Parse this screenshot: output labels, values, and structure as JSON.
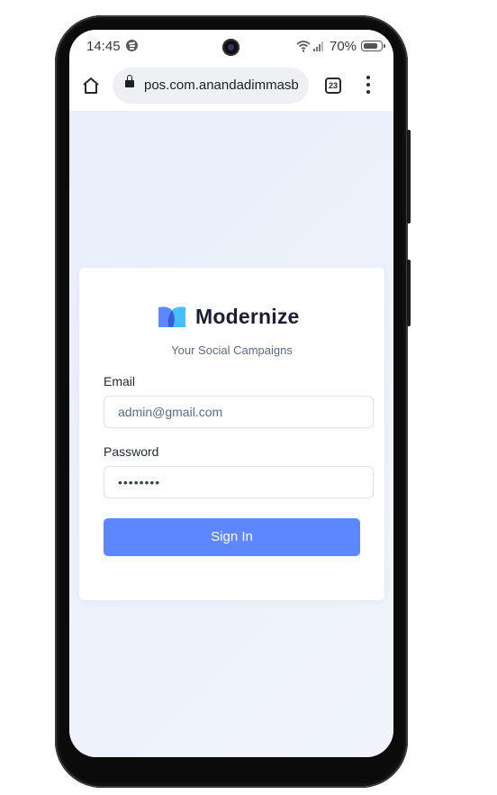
{
  "status_bar": {
    "time": "14:45",
    "battery_percent": "70%",
    "icons": [
      "spotify-icon",
      "wifi-icon",
      "signal-icon",
      "battery-icon"
    ]
  },
  "browser": {
    "url": "pos.com.anandadimmasb",
    "tab_count": "23",
    "icons": [
      "home-icon",
      "lock-icon",
      "tabs-icon",
      "more-menu-icon"
    ]
  },
  "login": {
    "brand_name": "Modernize",
    "tagline": "Your Social Campaigns",
    "email_label": "Email",
    "email_placeholder": "admin@gmail.com",
    "password_label": "Password",
    "password_value": "••••••••",
    "submit_label": "Sign In"
  },
  "colors": {
    "primary": "#5d87ff",
    "logo_left": "#5d87ff",
    "logo_right": "#49beff",
    "page_bg": "#eef3fb",
    "brand_text": "#1a1f36"
  }
}
